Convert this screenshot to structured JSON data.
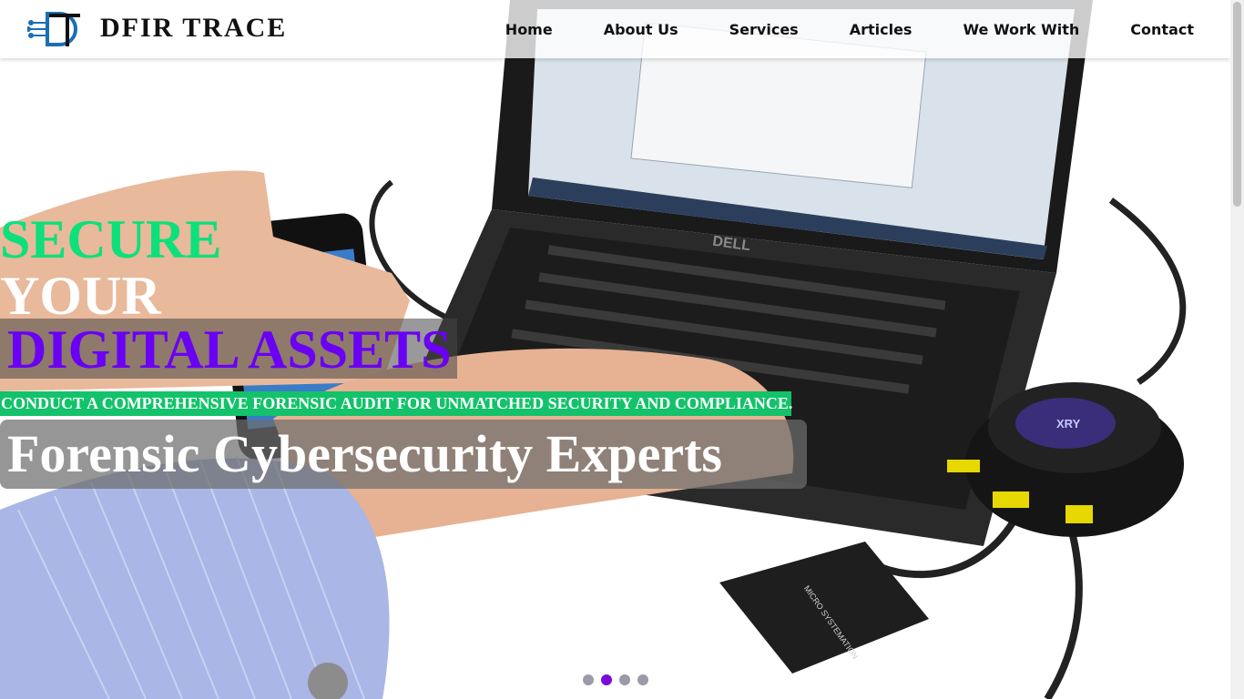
{
  "brand": {
    "name": "DFIR TRACE",
    "logo_icon": "dt-circuit-logo-icon"
  },
  "nav": {
    "items": [
      {
        "label": "Home"
      },
      {
        "label": "About Us"
      },
      {
        "label": "Services"
      },
      {
        "label": "Articles"
      },
      {
        "label": "We Work With"
      },
      {
        "label": "Contact"
      }
    ]
  },
  "hero": {
    "line1": "SECURE",
    "line2": "YOUR",
    "line3": "DIGITAL ASSETS",
    "subtitle": "CONDUCT A COMPREHENSIVE FORENSIC AUDIT FOR UNMATCHED SECURITY AND COMPLIANCE.",
    "tagline": "Forensic Cybersecurity Experts",
    "image_labels": {
      "laptop_brand": "DELL",
      "hub_brand": "XRY",
      "reader_brand": "MICRO SYSTEMATION"
    }
  },
  "carousel": {
    "slides": 4,
    "active_index": 1
  },
  "colors": {
    "accent_green": "#0de07a",
    "accent_purple": "#6a00f4",
    "subtitle_bar": "#13c26a",
    "dot_active": "#7a0bd8",
    "dot_inactive": "#9a9aa8"
  }
}
